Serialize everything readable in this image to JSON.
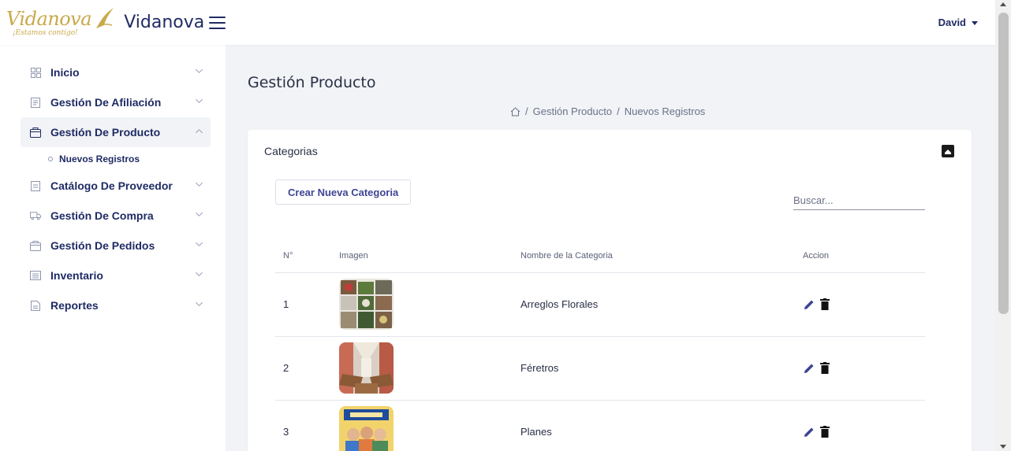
{
  "header": {
    "logo_script": "Vidanova",
    "logo_tagline": "¡Estamos contigo!",
    "brand": "Vidanova",
    "user_name": "David"
  },
  "sidebar": {
    "items": [
      {
        "label": "Inicio",
        "icon": "grid-icon"
      },
      {
        "label": "Gestión De Afiliación",
        "icon": "form-icon"
      },
      {
        "label": "Gestión De Producto",
        "icon": "box-icon",
        "expanded": true
      },
      {
        "label": "Catálogo De Proveedor",
        "icon": "document-icon"
      },
      {
        "label": "Gestión De Compra",
        "icon": "truck-icon"
      },
      {
        "label": "Gestión De Pedidos",
        "icon": "box-icon"
      },
      {
        "label": "Inventario",
        "icon": "list-icon"
      },
      {
        "label": "Reportes",
        "icon": "document-icon"
      }
    ],
    "sub_items": [
      {
        "label": "Nuevos Registros"
      }
    ]
  },
  "main": {
    "page_title": "Gestión Producto",
    "breadcrumb": [
      "Gestión Producto",
      "Nuevos Registros"
    ],
    "card_title": "Categorias",
    "create_button": "Crear Nueva Categoria",
    "search_placeholder": "Buscar...",
    "table": {
      "headers": [
        "N°",
        "Imagen",
        "Nombre de la Categoria",
        "Accion"
      ],
      "rows": [
        {
          "n": "1",
          "name": "Arreglos Florales"
        },
        {
          "n": "2",
          "name": "Féretros"
        },
        {
          "n": "3",
          "name": "Planes"
        }
      ]
    }
  },
  "colors": {
    "brand": "#1f2b64",
    "accent": "#3e4594",
    "gold": "#c9a94a",
    "background": "#f1f3f6"
  }
}
